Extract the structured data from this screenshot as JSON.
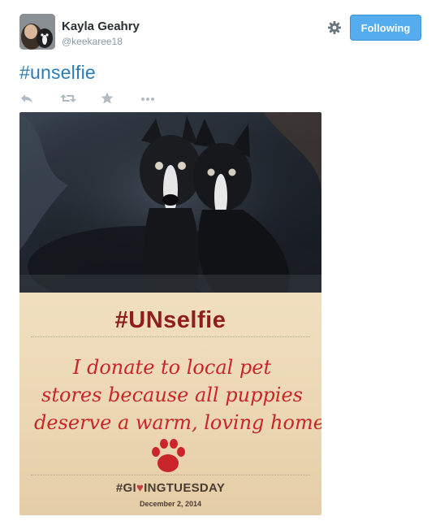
{
  "user": {
    "display_name": "Kayla Geahry",
    "screen_name": "@keekaree18"
  },
  "follow_button": {
    "label": "Following"
  },
  "tweet": {
    "hashtag_text": "#unselfie"
  },
  "actions": [
    "reply-icon",
    "retweet-icon",
    "favorite-icon",
    "more-icon"
  ],
  "photo": {
    "sign_title": "#UNselfie",
    "handwritten_lines": [
      "I donate to local pet",
      "stores because all puppies",
      "deserve a warm, loving home."
    ],
    "campaign_prefix": "#GI",
    "campaign_suffix": "INGTUESDAY",
    "date": "December 2, 2014"
  },
  "colors": {
    "accent": "#55acee",
    "link": "#2b7bb9",
    "sign_red": "#8e1d1c",
    "ink_red": "#c9252a"
  }
}
